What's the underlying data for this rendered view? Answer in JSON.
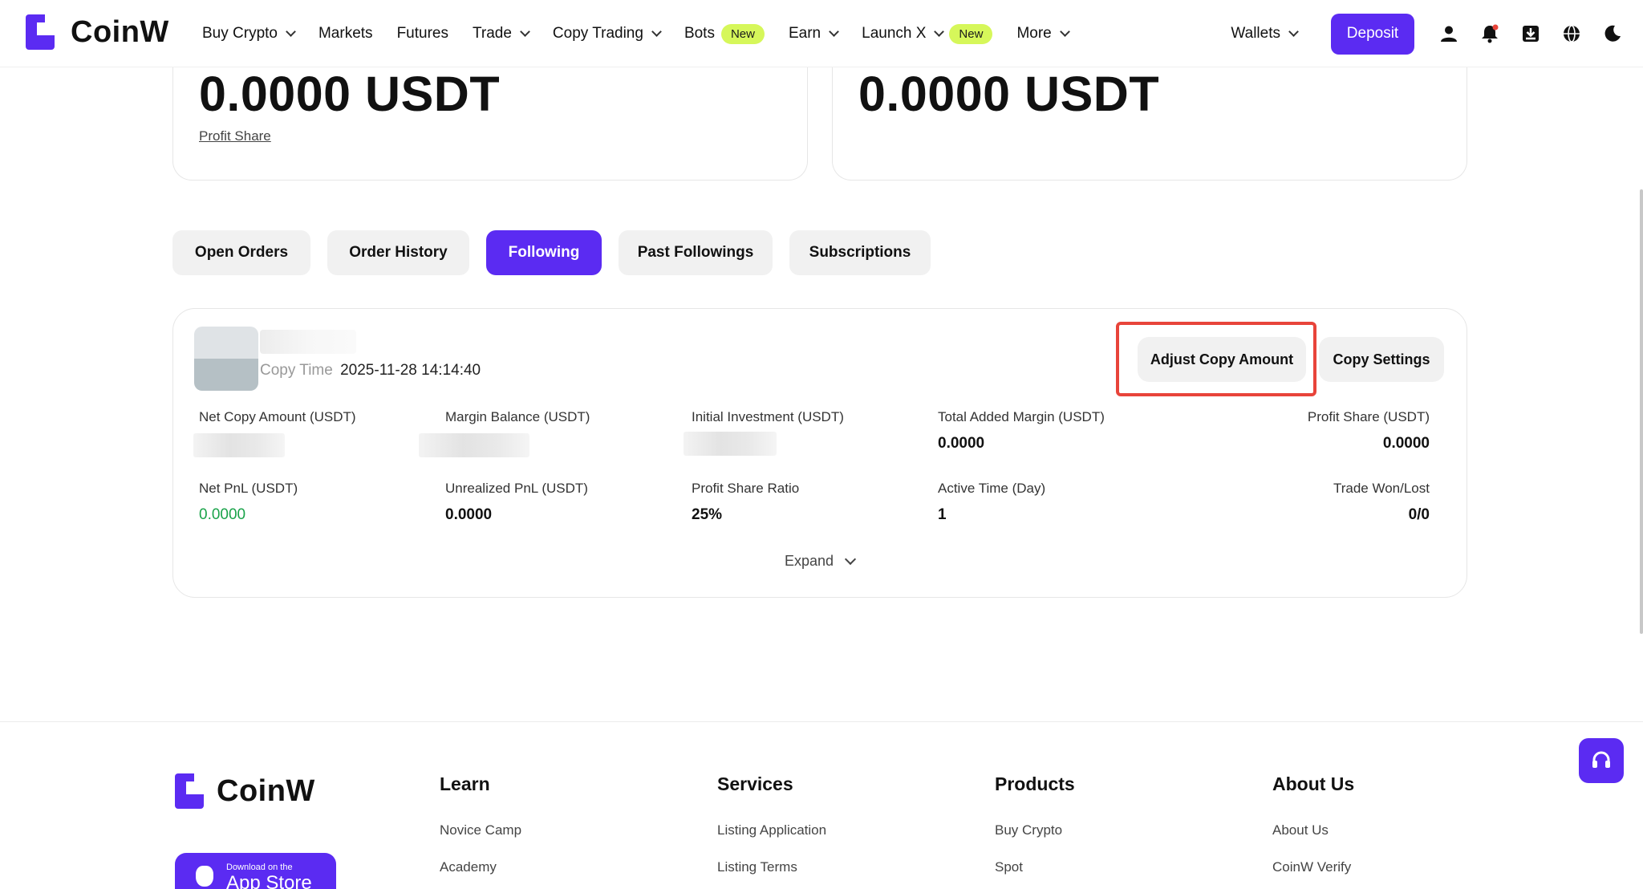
{
  "header": {
    "brand": "CoinW",
    "nav": [
      {
        "label": "Buy Crypto",
        "dropdown": true
      },
      {
        "label": "Markets",
        "dropdown": false
      },
      {
        "label": "Futures",
        "dropdown": false
      },
      {
        "label": "Trade",
        "dropdown": true
      },
      {
        "label": "Copy Trading",
        "dropdown": true
      },
      {
        "label": "Bots",
        "badge": "New"
      },
      {
        "label": "Earn",
        "dropdown": true
      },
      {
        "label": "Launch X",
        "dropdown": true,
        "badge": "New"
      },
      {
        "label": "More",
        "dropdown": true
      }
    ],
    "wallets_label": "Wallets",
    "deposit_label": "Deposit",
    "icons": [
      "user-icon",
      "bell-icon",
      "download-icon",
      "globe-icon",
      "moon-icon"
    ]
  },
  "summary": {
    "left_amount": "0.0000 USDT",
    "left_link": "Profit Share",
    "right_amount": "0.0000 USDT"
  },
  "tabs": [
    {
      "label": "Open Orders",
      "active": false
    },
    {
      "label": "Order History",
      "active": false
    },
    {
      "label": "Following",
      "active": true
    },
    {
      "label": "Past Followings",
      "active": false
    },
    {
      "label": "Subscriptions",
      "active": false
    }
  ],
  "following": {
    "copy_time_label": "Copy Time",
    "copy_time_value": "2025-11-28 14:14:40",
    "adjust_label": "Adjust Copy Amount",
    "settings_label": "Copy Settings",
    "stats_row1": [
      {
        "label": "Net Copy Amount (USDT)",
        "value": ""
      },
      {
        "label": "Margin Balance (USDT)",
        "value": ""
      },
      {
        "label": "Initial Investment (USDT)",
        "value": ""
      },
      {
        "label": "Total Added Margin (USDT)",
        "value": "0.0000"
      },
      {
        "label": "Profit Share (USDT)",
        "value": "0.0000"
      }
    ],
    "stats_row2": [
      {
        "label": "Net PnL (USDT)",
        "value": "0.0000"
      },
      {
        "label": "Unrealized PnL (USDT)",
        "value": "0.0000"
      },
      {
        "label": "Profit Share Ratio",
        "value": "25%"
      },
      {
        "label": "Active Time (Day)",
        "value": "1"
      },
      {
        "label": "Trade Won/Lost",
        "value": "0/0"
      }
    ],
    "expand_label": "Expand",
    "pnl_color": "#1aa34a"
  },
  "footer": {
    "brand": "CoinW",
    "appstore_small": "Download on the",
    "appstore_large": "App Store",
    "columns": [
      {
        "title": "Learn",
        "links": [
          "Novice Camp",
          "Academy"
        ]
      },
      {
        "title": "Services",
        "links": [
          "Listing Application",
          "Listing Terms"
        ]
      },
      {
        "title": "Products",
        "links": [
          "Buy Crypto",
          "Spot"
        ]
      },
      {
        "title": "About Us",
        "links": [
          "About Us",
          "CoinW Verify"
        ]
      }
    ]
  },
  "colors": {
    "accent": "#5b2bf2",
    "badge": "#d6f75a",
    "highlight": "#e8443a"
  }
}
